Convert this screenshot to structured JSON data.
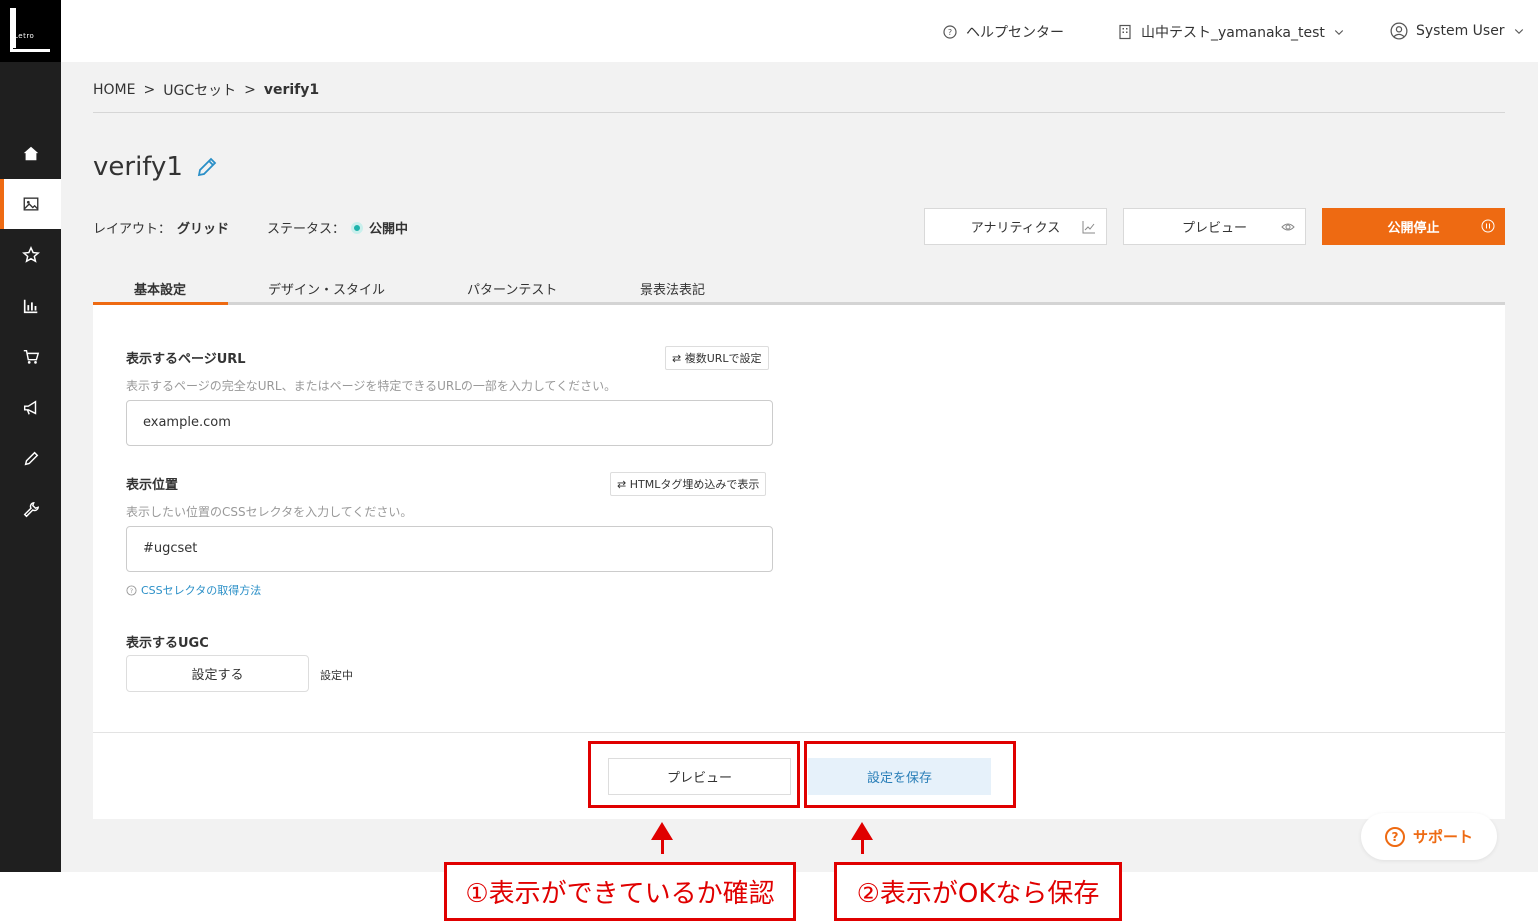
{
  "header": {
    "help_center": "ヘルプセンター",
    "account": "山中テスト_yamanaka_test",
    "user": "System User"
  },
  "logo": {
    "text": "Letro"
  },
  "sidebar": {
    "items": [
      {
        "name": "home-icon"
      },
      {
        "name": "image-icon"
      },
      {
        "name": "star-icon"
      },
      {
        "name": "chart-icon"
      },
      {
        "name": "cart-icon"
      },
      {
        "name": "megaphone-icon"
      },
      {
        "name": "pencil-icon"
      },
      {
        "name": "wrench-icon"
      }
    ],
    "active_index": 1
  },
  "breadcrumb": {
    "home": "HOME",
    "sep": ">",
    "parent": "UGCセット",
    "current": "verify1"
  },
  "page": {
    "title": "verify1",
    "layout_label": "レイアウト：",
    "layout_value": "グリッド",
    "status_label": "ステータス：",
    "status_value": "公開中",
    "status_color": "#1fb3ac"
  },
  "actions": {
    "analytics": "アナリティクス",
    "preview": "プレビュー",
    "unpublish": "公開停止",
    "accent_color": "#ee6a12"
  },
  "tabs": [
    {
      "label": "基本設定",
      "active": true
    },
    {
      "label": "デザイン・スタイル",
      "active": false
    },
    {
      "label": "パターンテスト",
      "active": false
    },
    {
      "label": "景表法表記",
      "active": false
    }
  ],
  "form": {
    "url_label": "表示するページURL",
    "url_multi_button": "⇄ 複数URLで設定",
    "url_help": "表示するページの完全なURL、またはページを特定できるURLの一部を入力してください。",
    "url_value": "example.com",
    "position_label": "表示位置",
    "position_button": "⇄ HTMLタグ埋め込みで表示",
    "position_help": "表示したい位置のCSSセレクタを入力してください。",
    "position_value": "#ugcset",
    "css_link": "CSSセレクタの取得方法",
    "ugc_label": "表示するUGC",
    "ugc_button": "設定する",
    "ugc_status": "設定中"
  },
  "footer": {
    "preview": "プレビュー",
    "save": "設定を保存"
  },
  "annotations": {
    "callout1": "①表示ができているか確認",
    "callout2": "②表示がOKなら保存",
    "color": "#e00000"
  },
  "support": {
    "label": "サポート"
  }
}
